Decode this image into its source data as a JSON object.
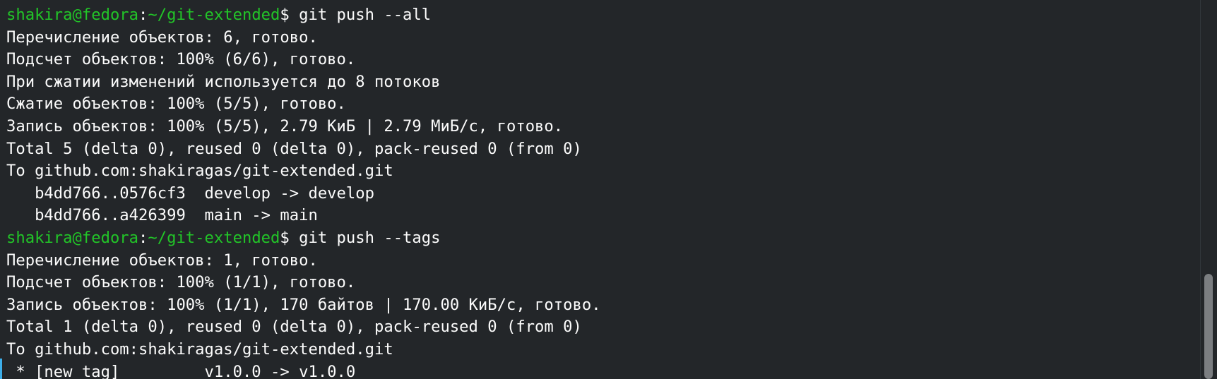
{
  "terminal": {
    "prompt": {
      "user_host": "shakira@fedora",
      "separator": ":",
      "path": "~/git-extended",
      "dollar": "$"
    },
    "commands": [
      " git push --all",
      " git push --tags"
    ],
    "output_block_1": [
      "Перечисление объектов: 6, готово.",
      "Подсчет объектов: 100% (6/6), готово.",
      "При сжатии изменений используется до 8 потоков",
      "Сжатие объектов: 100% (5/5), готово.",
      "Запись объектов: 100% (5/5), 2.79 КиБ | 2.79 МиБ/с, готово.",
      "Total 5 (delta 0), reused 0 (delta 0), pack-reused 0 (from 0)",
      "To github.com:shakiragas/git-extended.git",
      "   b4dd766..0576cf3  develop -> develop",
      "   b4dd766..a426399  main -> main"
    ],
    "output_block_2": [
      "Перечисление объектов: 1, готово.",
      "Подсчет объектов: 100% (1/1), готово.",
      "Запись объектов: 100% (1/1), 170 байтов | 170.00 КиБ/с, готово.",
      "Total 1 (delta 0), reused 0 (delta 0), pack-reused 0 (from 0)",
      "To github.com:shakiragas/git-extended.git",
      " * [new tag]         v1.0.0 -> v1.0.0"
    ]
  },
  "colors": {
    "background": "#232629",
    "text": "#fcfcfc",
    "prompt_green": "#22c528",
    "marker_blue": "#3daee9",
    "scrollbar_thumb": "#7b7e81"
  }
}
